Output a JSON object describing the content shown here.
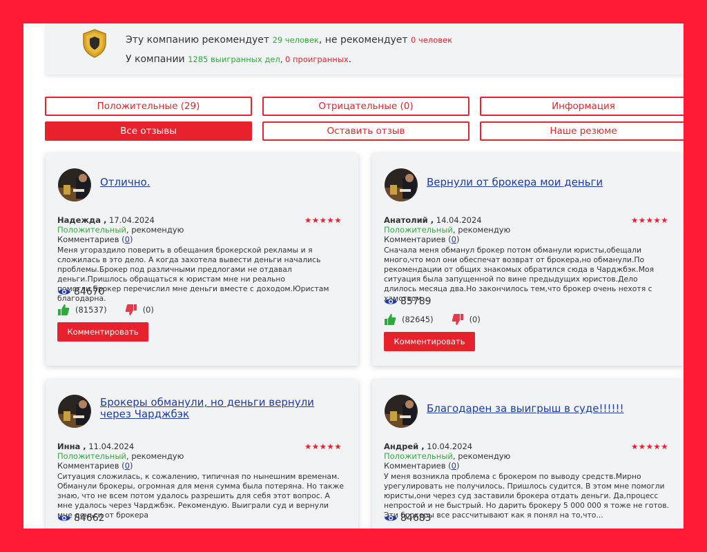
{
  "summary": {
    "rec_prefix": "Эту компанию рекомендует ",
    "rec_count": "29 человек",
    "rec_middle": ", не рекомендует ",
    "notrec_count": "0 человек",
    "cases_prefix": "У компании ",
    "won": "1285 выигранных дел",
    "comma": ", ",
    "lost": "0 проигранных",
    "period": "."
  },
  "buttons": {
    "positive": "Положительные (29)",
    "negative": "Отрицательные (0)",
    "info": "Информация",
    "all": "Все отзывы",
    "leave": "Оставить отзыв",
    "resume": "Наше резюме"
  },
  "common": {
    "positive": "Положительный",
    "recommend": ", рекомендую",
    "comments_label": "Комментариев (",
    "comments_close": ")",
    "comment_button": "Комментировать",
    "stars": "★★★★★",
    "colors": {
      "brand_red": "#e8222d",
      "positive_green": "#2eaa3c",
      "link_blue": "#1f3aa8",
      "frame_red": "#ff1a35"
    }
  },
  "reviews": [
    {
      "title": "Отлично.",
      "author": "Надежда",
      "date": "17.04.2024",
      "comments": "0",
      "text": "Меня угораздило поверить в обещания брокерской рекламы и я сложилась в это дело. А когда захотела вывести деньги начались проблемы.Брокер под различными предлогами не отдавал деньги.Пришлось обращаться к юристам мне ни реально помогли.Брокер перечислил мне деньги вместе с доходом.Юристам благодарна.",
      "views": "84670",
      "likes": "(81537)",
      "dislikes": "(0)"
    },
    {
      "title": "Вернули от брокера мои деньги",
      "author": "Анатолий",
      "date": "14.04.2024",
      "comments": "0",
      "text": "Сначала меня обманул брокер потом обманули юристы,обещали много,что мол они обеспечат возврат от брокера,но обманули.По рекомендации от общих знакомых обратился сюда в Чарджбэк.Моя ситуация была запущенной по вине предыдущих юристов.Дело длилось месяца два.Но закончилось тем,что брокер очень нехотя с хамством...",
      "views": "85789",
      "likes": "(82645)",
      "dislikes": "(0)"
    },
    {
      "title": "Брокеры обманули, но деньги вернули через Чарджбэк",
      "author": "Инна",
      "date": "11.04.2024",
      "comments": "0",
      "text": "Ситуация сложилась, к сожалению, типичная по нынешним временам. Обманули брокеры, огромная для меня сумма была потеряна. Но также знаю, что не всем потом удалось разрешить для себя этот вопрос. А мне удалось через Чарджбэк. Рекомендую. Выиграли суд и вернули мне деньги от брокера",
      "views": "84662"
    },
    {
      "title": "Благодарен за выигрыш в суде!!!!!!",
      "author": "Андрей",
      "date": "10.04.2024",
      "comments": "0",
      "text": "У меня возникла проблема с брокером по выводу средств.Мирно урегулировать не получилось. Пришлось судится. В этом мне помогли юристы,они через суд заставили брокера отдать деньги. Да,процесс непростой и не быстрый. Но дарить брокеру 5 000 000 я тоже не готов. Эти брокеры все рассчитывают как я понял на то,что...",
      "views": "84683"
    }
  ]
}
